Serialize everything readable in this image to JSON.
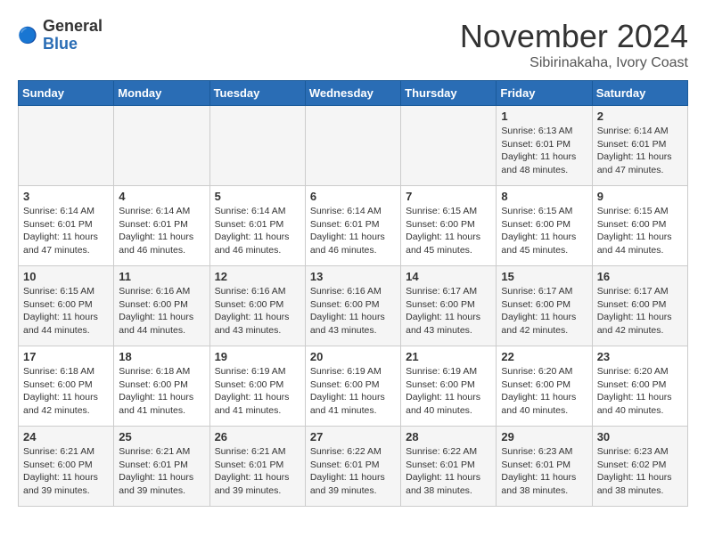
{
  "header": {
    "logo_general": "General",
    "logo_blue": "Blue",
    "month_title": "November 2024",
    "location": "Sibirinakaha, Ivory Coast"
  },
  "days_of_week": [
    "Sunday",
    "Monday",
    "Tuesday",
    "Wednesday",
    "Thursday",
    "Friday",
    "Saturday"
  ],
  "weeks": [
    [
      {
        "day": "",
        "info": ""
      },
      {
        "day": "",
        "info": ""
      },
      {
        "day": "",
        "info": ""
      },
      {
        "day": "",
        "info": ""
      },
      {
        "day": "",
        "info": ""
      },
      {
        "day": "1",
        "info": "Sunrise: 6:13 AM\nSunset: 6:01 PM\nDaylight: 11 hours\nand 48 minutes."
      },
      {
        "day": "2",
        "info": "Sunrise: 6:14 AM\nSunset: 6:01 PM\nDaylight: 11 hours\nand 47 minutes."
      }
    ],
    [
      {
        "day": "3",
        "info": "Sunrise: 6:14 AM\nSunset: 6:01 PM\nDaylight: 11 hours\nand 47 minutes."
      },
      {
        "day": "4",
        "info": "Sunrise: 6:14 AM\nSunset: 6:01 PM\nDaylight: 11 hours\nand 46 minutes."
      },
      {
        "day": "5",
        "info": "Sunrise: 6:14 AM\nSunset: 6:01 PM\nDaylight: 11 hours\nand 46 minutes."
      },
      {
        "day": "6",
        "info": "Sunrise: 6:14 AM\nSunset: 6:01 PM\nDaylight: 11 hours\nand 46 minutes."
      },
      {
        "day": "7",
        "info": "Sunrise: 6:15 AM\nSunset: 6:00 PM\nDaylight: 11 hours\nand 45 minutes."
      },
      {
        "day": "8",
        "info": "Sunrise: 6:15 AM\nSunset: 6:00 PM\nDaylight: 11 hours\nand 45 minutes."
      },
      {
        "day": "9",
        "info": "Sunrise: 6:15 AM\nSunset: 6:00 PM\nDaylight: 11 hours\nand 44 minutes."
      }
    ],
    [
      {
        "day": "10",
        "info": "Sunrise: 6:15 AM\nSunset: 6:00 PM\nDaylight: 11 hours\nand 44 minutes."
      },
      {
        "day": "11",
        "info": "Sunrise: 6:16 AM\nSunset: 6:00 PM\nDaylight: 11 hours\nand 44 minutes."
      },
      {
        "day": "12",
        "info": "Sunrise: 6:16 AM\nSunset: 6:00 PM\nDaylight: 11 hours\nand 43 minutes."
      },
      {
        "day": "13",
        "info": "Sunrise: 6:16 AM\nSunset: 6:00 PM\nDaylight: 11 hours\nand 43 minutes."
      },
      {
        "day": "14",
        "info": "Sunrise: 6:17 AM\nSunset: 6:00 PM\nDaylight: 11 hours\nand 43 minutes."
      },
      {
        "day": "15",
        "info": "Sunrise: 6:17 AM\nSunset: 6:00 PM\nDaylight: 11 hours\nand 42 minutes."
      },
      {
        "day": "16",
        "info": "Sunrise: 6:17 AM\nSunset: 6:00 PM\nDaylight: 11 hours\nand 42 minutes."
      }
    ],
    [
      {
        "day": "17",
        "info": "Sunrise: 6:18 AM\nSunset: 6:00 PM\nDaylight: 11 hours\nand 42 minutes."
      },
      {
        "day": "18",
        "info": "Sunrise: 6:18 AM\nSunset: 6:00 PM\nDaylight: 11 hours\nand 41 minutes."
      },
      {
        "day": "19",
        "info": "Sunrise: 6:19 AM\nSunset: 6:00 PM\nDaylight: 11 hours\nand 41 minutes."
      },
      {
        "day": "20",
        "info": "Sunrise: 6:19 AM\nSunset: 6:00 PM\nDaylight: 11 hours\nand 41 minutes."
      },
      {
        "day": "21",
        "info": "Sunrise: 6:19 AM\nSunset: 6:00 PM\nDaylight: 11 hours\nand 40 minutes."
      },
      {
        "day": "22",
        "info": "Sunrise: 6:20 AM\nSunset: 6:00 PM\nDaylight: 11 hours\nand 40 minutes."
      },
      {
        "day": "23",
        "info": "Sunrise: 6:20 AM\nSunset: 6:00 PM\nDaylight: 11 hours\nand 40 minutes."
      }
    ],
    [
      {
        "day": "24",
        "info": "Sunrise: 6:21 AM\nSunset: 6:00 PM\nDaylight: 11 hours\nand 39 minutes."
      },
      {
        "day": "25",
        "info": "Sunrise: 6:21 AM\nSunset: 6:01 PM\nDaylight: 11 hours\nand 39 minutes."
      },
      {
        "day": "26",
        "info": "Sunrise: 6:21 AM\nSunset: 6:01 PM\nDaylight: 11 hours\nand 39 minutes."
      },
      {
        "day": "27",
        "info": "Sunrise: 6:22 AM\nSunset: 6:01 PM\nDaylight: 11 hours\nand 39 minutes."
      },
      {
        "day": "28",
        "info": "Sunrise: 6:22 AM\nSunset: 6:01 PM\nDaylight: 11 hours\nand 38 minutes."
      },
      {
        "day": "29",
        "info": "Sunrise: 6:23 AM\nSunset: 6:01 PM\nDaylight: 11 hours\nand 38 minutes."
      },
      {
        "day": "30",
        "info": "Sunrise: 6:23 AM\nSunset: 6:02 PM\nDaylight: 11 hours\nand 38 minutes."
      }
    ]
  ]
}
